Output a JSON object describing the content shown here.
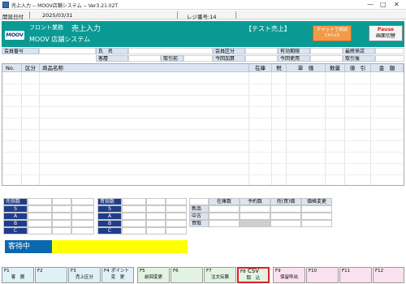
{
  "window": {
    "title": "売上入力 -- MOOV店舗システム -- Ver3.21.02T",
    "controls": [
      "—",
      "□",
      "✕"
    ]
  },
  "info": {
    "date_label": "開設日付",
    "date_value": "2025/03/31",
    "register_label": "レジ番号:14"
  },
  "header": {
    "section": "フロント業務",
    "screen": "売上入力",
    "system": "MOOV 店舗システム",
    "mode": "【テスト売上】",
    "logo": "MOOV",
    "chat": {
      "line1": "チャットで相談",
      "line2": "Ctrl+S"
    },
    "pause": {
      "line1": "Pause",
      "line2": "画面切替"
    }
  },
  "fields": {
    "member_no": "会員番号",
    "name": "氏　名",
    "member_class": "会員区分",
    "valid_term": "有効期限",
    "last_visit": "最終来店",
    "customer_layer": "客層",
    "discount_before": "取引前",
    "this_add": "今回加算",
    "this_use": "今回使用",
    "discount_after": "取引後"
  },
  "table": {
    "columns": [
      "No.",
      "区分",
      "商品名称",
      "在庫",
      "税",
      "単　価",
      "数量",
      "値　引",
      "金　額"
    ]
  },
  "stock": {
    "sell_title": "売指数",
    "buy_title": "買指数",
    "ranks": [
      "S",
      "A",
      "B",
      "C"
    ],
    "headers": [
      "在庫数",
      "予約数",
      "売(買)価",
      "価格変更"
    ],
    "rows": [
      "新品",
      "中古",
      "買取"
    ]
  },
  "status": {
    "label": "客待中"
  },
  "fkeys": [
    {
      "n": "F1",
      "l": "客　層"
    },
    {
      "n": "F2",
      "l": ""
    },
    {
      "n": "F3",
      "l": "売上区分"
    },
    {
      "n": "F4",
      "l": "ポイント",
      "l2": "変　更"
    },
    {
      "n": "F5",
      "l": "前回変更"
    },
    {
      "n": "F6",
      "l": ""
    },
    {
      "n": "F7",
      "l": "注文伝票"
    },
    {
      "n": "F8",
      "l": "CSV",
      "l2": "取　込"
    },
    {
      "n": "F9",
      "l": "保留呼出"
    },
    {
      "n": "F10",
      "l": ""
    },
    {
      "n": "F11",
      "l": ""
    },
    {
      "n": "F12",
      "l": ""
    }
  ],
  "colors": {
    "header": "#0a9a94",
    "label": "#dbe5f1",
    "status": "#0b68b0",
    "status_bar": "#ffff00",
    "highlight": "#e02020"
  }
}
